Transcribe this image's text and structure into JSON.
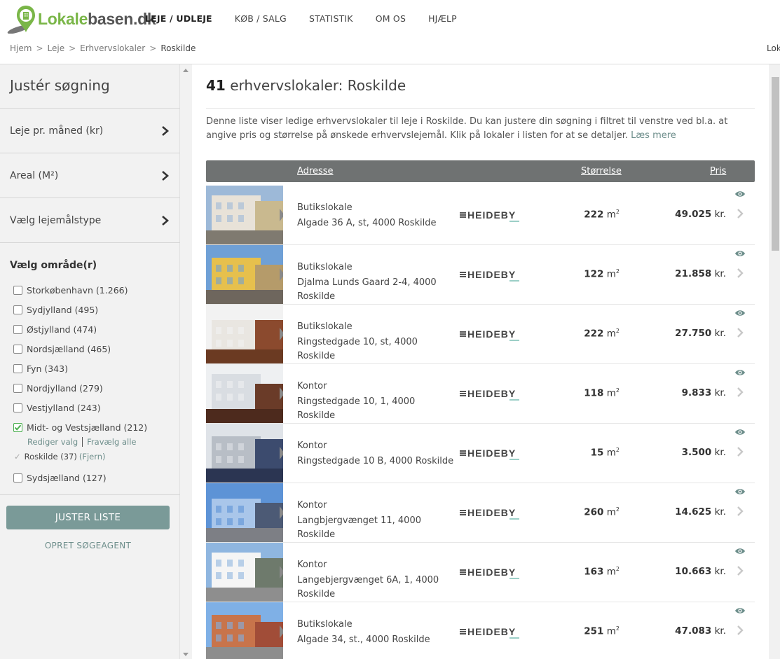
{
  "header": {
    "logo_part1": "Lokale",
    "logo_part2": "basen.dk",
    "nav": [
      {
        "label": "LEJE / UDLEJE",
        "active": true
      },
      {
        "label": "KØB / SALG",
        "active": false
      },
      {
        "label": "STATISTIK",
        "active": false
      },
      {
        "label": "OM OS",
        "active": false
      },
      {
        "label": "HJÆLP",
        "active": false
      }
    ],
    "breadcrumb": [
      "Hjem",
      "Leje",
      "Erhvervslokaler",
      "Roskilde"
    ],
    "breadcrumb_sep": ">",
    "right_text": "Lok"
  },
  "sidebar": {
    "title": "Justér søgning",
    "filters": [
      "Leje pr. måned (kr)",
      "Areal (M²)",
      "Vælg lejemålstype"
    ],
    "area_heading": "Vælg område(r)",
    "areas": [
      {
        "label": "Storkøbenhavn (1.266)",
        "checked": false
      },
      {
        "label": "Sydjylland (495)",
        "checked": false
      },
      {
        "label": "Østjylland (474)",
        "checked": false
      },
      {
        "label": "Nordsjælland (465)",
        "checked": false
      },
      {
        "label": "Fyn (343)",
        "checked": false
      },
      {
        "label": "Nordjylland (279)",
        "checked": false
      },
      {
        "label": "Vestjylland (243)",
        "checked": false
      },
      {
        "label": "Midt- og Vestsjælland (212)",
        "checked": true
      }
    ],
    "edit_link": "Rediger valg",
    "deselect_link": "Fravælg alle",
    "selected_sub": "Roskilde (37)",
    "remove_link": "(Fjern)",
    "extra_area": {
      "label": "Sydsjælland (127)",
      "checked": false
    },
    "adjust_button": "JUSTER LISTE",
    "agent_link": "OPRET SØGEAGENT"
  },
  "main": {
    "count": "41",
    "title_rest": "erhvervslokaler: Roskilde",
    "intro": "Denne liste viser ledige erhvervslokaler til leje i Roskilde. Du kan justere din søgning i filtret til venstre ved bl.a. at angive pris og størrelse på ønskede erhvervslejemål. Klik på lokaler i listen for at se detaljer.",
    "read_more": "Læs mere",
    "columns": {
      "address": "Adresse",
      "size": "Størrelse",
      "price": "Pris"
    },
    "landlord": "HEIDEBY",
    "size_unit": "m",
    "size_sup": "2",
    "price_unit": "kr.",
    "listings": [
      {
        "type": "Butikslokale",
        "address": "Algade 36 A, st, 4000 Roskilde",
        "size": "222",
        "price": "49.025"
      },
      {
        "type": "Butikslokale",
        "address": "Djalma Lunds Gaard 2-4, 4000 Roskilde",
        "size": "122",
        "price": "21.858"
      },
      {
        "type": "Butikslokale",
        "address": "Ringstedgade 10, st, 4000 Roskilde",
        "size": "222",
        "price": "27.750"
      },
      {
        "type": "Kontor",
        "address": "Ringstedgade 10, 1, 4000 Roskilde",
        "size": "118",
        "price": "9.833"
      },
      {
        "type": "Kontor",
        "address": "Ringstedgade 10 B, 4000 Roskilde",
        "size": "15",
        "price": "3.500"
      },
      {
        "type": "Kontor",
        "address": "Langbjergvænget 11, 4000 Roskilde",
        "size": "260",
        "price": "14.625"
      },
      {
        "type": "Kontor",
        "address": "Langebjergvænget 6A, 1, 4000 Roskilde",
        "size": "163",
        "price": "10.663"
      },
      {
        "type": "Butikslokale",
        "address": "Algade 34, st., 4000 Roskilde",
        "size": "251",
        "price": "47.083"
      }
    ]
  },
  "colors": {
    "brand_green": "#7ab648",
    "accent_teal": "#6d8e8b",
    "table_header": "#6f7272",
    "button": "#7a9a98"
  }
}
